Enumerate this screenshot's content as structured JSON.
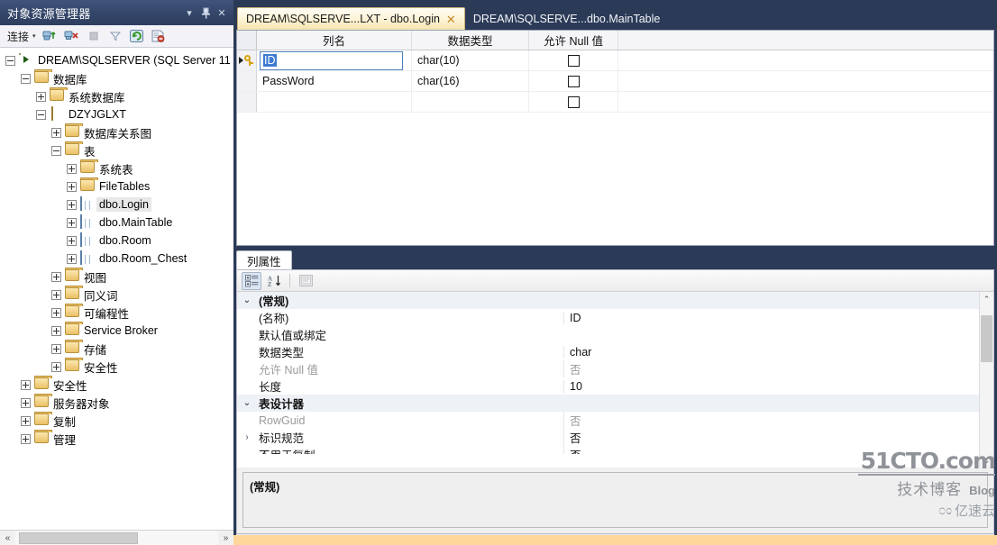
{
  "object_explorer": {
    "title": "对象资源管理器",
    "titlebar_buttons": [
      {
        "name": "window-menu-icon",
        "glyph": "▾"
      },
      {
        "name": "pin-icon",
        "glyph": "⌶"
      },
      {
        "name": "close-icon",
        "glyph": "✕"
      }
    ],
    "toolbar": {
      "connect_label": "连接",
      "connect_caret": "▾",
      "buttons": [
        {
          "name": "connect-object-explorer-icon"
        },
        {
          "name": "disconnect-object-explorer-icon"
        },
        {
          "name": "stop-icon"
        },
        {
          "name": "filter-icon"
        },
        {
          "name": "refresh-icon"
        },
        {
          "name": "script-icon"
        }
      ]
    },
    "tree": [
      {
        "label": "DREAM\\SQLSERVER (SQL Server 11",
        "indent": 0,
        "state": "expanded",
        "icon": "server-icon"
      },
      {
        "label": "数据库",
        "indent": 1,
        "state": "expanded",
        "icon": "folder-icon"
      },
      {
        "label": "系统数据库",
        "indent": 2,
        "state": "collapsed",
        "icon": "folder-icon"
      },
      {
        "label": "DZYJGLXT",
        "indent": 2,
        "state": "expanded",
        "icon": "database-icon"
      },
      {
        "label": "数据库关系图",
        "indent": 3,
        "state": "collapsed",
        "icon": "folder-icon"
      },
      {
        "label": "表",
        "indent": 3,
        "state": "expanded",
        "icon": "folder-icon"
      },
      {
        "label": "系统表",
        "indent": 4,
        "state": "collapsed",
        "icon": "folder-icon"
      },
      {
        "label": "FileTables",
        "indent": 4,
        "state": "collapsed",
        "icon": "folder-icon"
      },
      {
        "label": "dbo.Login",
        "indent": 4,
        "state": "collapsed",
        "icon": "table-icon",
        "selected": true
      },
      {
        "label": "dbo.MainTable",
        "indent": 4,
        "state": "collapsed",
        "icon": "table-icon"
      },
      {
        "label": "dbo.Room",
        "indent": 4,
        "state": "collapsed",
        "icon": "table-icon"
      },
      {
        "label": "dbo.Room_Chest",
        "indent": 4,
        "state": "collapsed",
        "icon": "table-icon"
      },
      {
        "label": "视图",
        "indent": 3,
        "state": "collapsed",
        "icon": "folder-icon"
      },
      {
        "label": "同义词",
        "indent": 3,
        "state": "collapsed",
        "icon": "folder-icon"
      },
      {
        "label": "可编程性",
        "indent": 3,
        "state": "collapsed",
        "icon": "folder-icon"
      },
      {
        "label": "Service Broker",
        "indent": 3,
        "state": "collapsed",
        "icon": "folder-icon"
      },
      {
        "label": "存储",
        "indent": 3,
        "state": "collapsed",
        "icon": "folder-icon"
      },
      {
        "label": "安全性",
        "indent": 3,
        "state": "collapsed",
        "icon": "folder-icon"
      },
      {
        "label": "安全性",
        "indent": 1,
        "state": "collapsed",
        "icon": "folder-icon"
      },
      {
        "label": "服务器对象",
        "indent": 1,
        "state": "collapsed",
        "icon": "folder-icon"
      },
      {
        "label": "复制",
        "indent": 1,
        "state": "collapsed",
        "icon": "folder-icon"
      },
      {
        "label": "管理",
        "indent": 1,
        "state": "collapsed",
        "icon": "folder-icon"
      }
    ],
    "hscroll": {
      "left_glyph": "«",
      "right_glyph": "»"
    }
  },
  "tabs": {
    "items": [
      {
        "label": "DREAM\\SQLSERVE...LXT - dbo.Login",
        "active": true,
        "close_glyph": "✕"
      },
      {
        "label": "DREAM\\SQLSERVE...dbo.MainTable",
        "active": false
      }
    ],
    "dropdown_glyph": "▾"
  },
  "designer": {
    "headers": {
      "row_selector": "",
      "column_name": "列名",
      "data_type": "数据类型",
      "allow_nulls": "允许 Null 值"
    },
    "rows": [
      {
        "name": "ID",
        "type": "char(10)",
        "allow_null": false,
        "primary_key": true,
        "current": true,
        "editing": true
      },
      {
        "name": "PassWord",
        "type": "char(16)",
        "allow_null": false,
        "primary_key": false,
        "current": false,
        "editing": false
      },
      {
        "name": "",
        "type": "",
        "allow_null": false,
        "primary_key": false,
        "current": false,
        "editing": false
      }
    ]
  },
  "properties": {
    "tab_label": "列属性",
    "toolbar": [
      {
        "name": "categorized-view-icon",
        "active": true
      },
      {
        "name": "alphabetical-sort-icon",
        "active": false
      },
      {
        "name": "property-pages-icon",
        "active": false,
        "disabled": true
      }
    ],
    "rows": [
      {
        "kind": "category",
        "name": "(常规)",
        "value": "",
        "twisty": "⌄"
      },
      {
        "kind": "prop",
        "name": "(名称)",
        "value": "ID",
        "dim": false
      },
      {
        "kind": "prop",
        "name": "默认值或绑定",
        "value": "",
        "dim": false
      },
      {
        "kind": "prop",
        "name": "数据类型",
        "value": "char",
        "dim": false
      },
      {
        "kind": "prop",
        "name": "允许 Null 值",
        "value": "否",
        "dim": true
      },
      {
        "kind": "prop",
        "name": "长度",
        "value": "10",
        "dim": false
      },
      {
        "kind": "category",
        "name": "表设计器",
        "value": "",
        "twisty": "⌄"
      },
      {
        "kind": "prop",
        "name": "RowGuid",
        "value": "否",
        "dim": true
      },
      {
        "kind": "prop",
        "name": "标识规范",
        "value": "否",
        "dim": false,
        "twisty": "›"
      },
      {
        "kind": "prop",
        "name": "不用于复制",
        "value": "否",
        "dim": false,
        "clipped": true
      }
    ],
    "description": "(常规)",
    "scroll": {
      "up_glyph": "⌃",
      "down_glyph": "⌄"
    }
  },
  "watermark": {
    "line1": "51CTO.com",
    "line2_a": "技术博客",
    "line2_b": "Blog",
    "line3_glyph": "೦ಂ",
    "line3_text": "亿速云"
  },
  "colors": {
    "chrome": "#2b3a57",
    "active_tab": "#fdf3d4",
    "selection": "#3d7bd0",
    "status_bar": "#ffd79a"
  }
}
